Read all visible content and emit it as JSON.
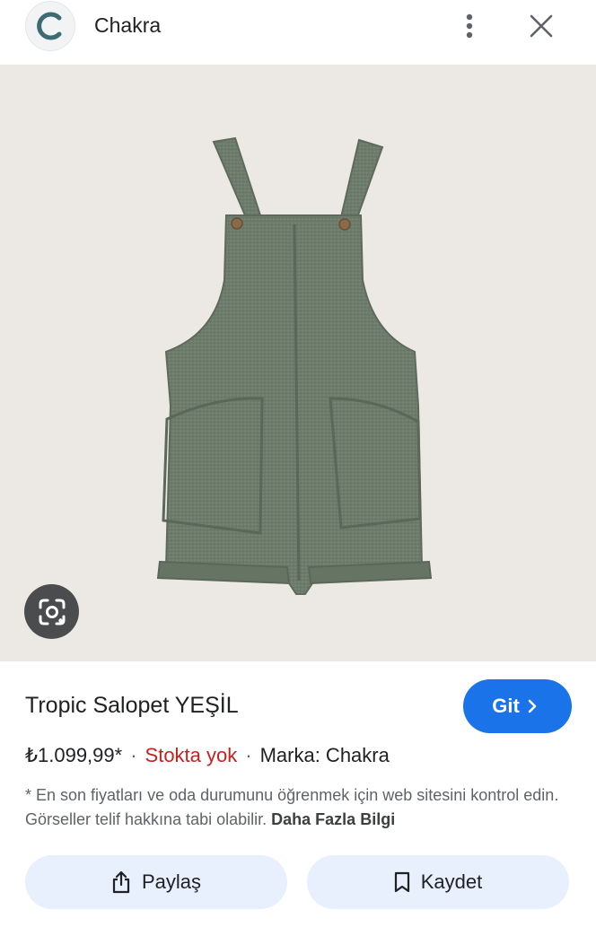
{
  "header": {
    "logo_letter": "C",
    "site_name": "Chakra",
    "icons": {
      "more": "more-vert-icon",
      "close": "close-icon"
    }
  },
  "image": {
    "subject": "green sleeveless romper overalls with buttons and front pockets",
    "background_color": "#ece9e5",
    "garment_color": "#6e7c6c",
    "lens_icon": "lens-icon"
  },
  "product": {
    "title": "Tropic Salopet YEŞİL",
    "go_label": "Git",
    "price": "₺1.099,99*",
    "separator": "·",
    "stock_status": "Stokta yok",
    "brand": "Marka: Chakra",
    "disclaimer": "* En son fiyatları ve oda durumunu öğrenmek için web sitesini kontrol edin. Görseller telif hakkına tabi olabilir.",
    "more_info": "Daha Fazla Bilgi"
  },
  "actions": {
    "share_label": "Paylaş",
    "save_label": "Kaydet"
  },
  "colors": {
    "accent": "#1a73e8",
    "stock_out": "#c5221f",
    "pill_bg": "#e8f0fe"
  }
}
